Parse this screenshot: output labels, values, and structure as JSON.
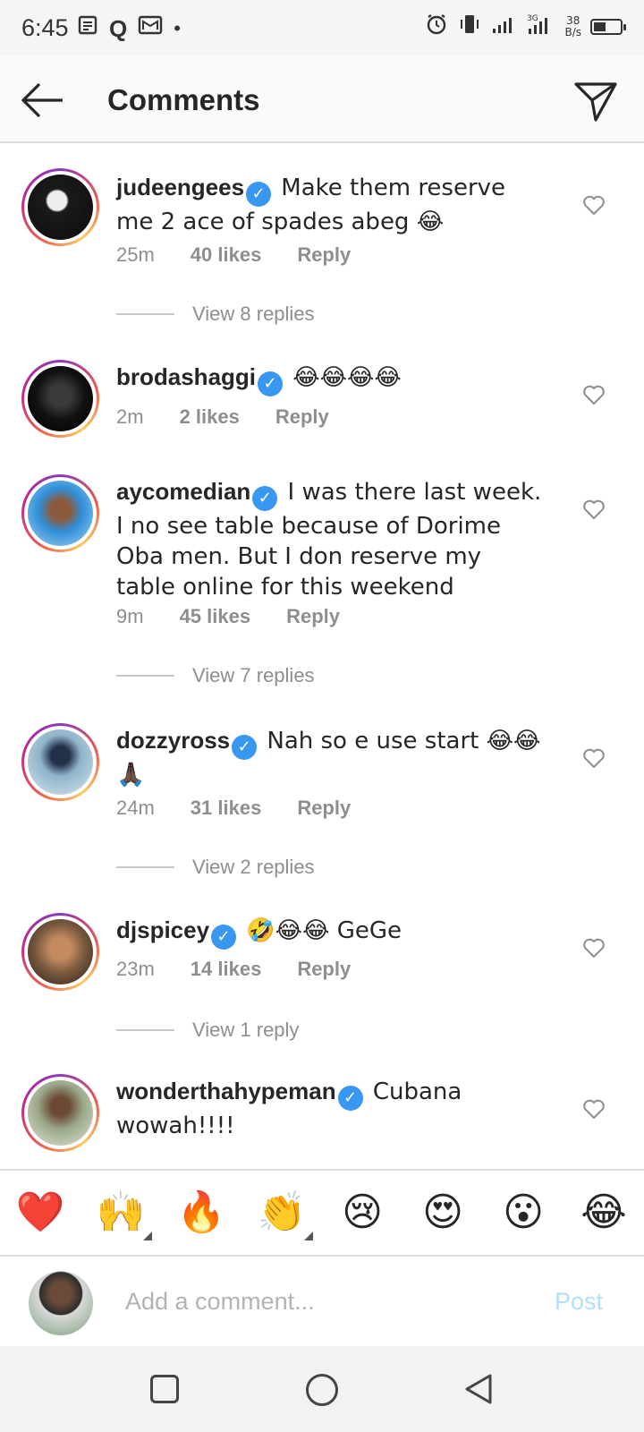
{
  "status_bar": {
    "time": "6:45",
    "left_icons": [
      "notes-icon",
      "q-app-icon",
      "mail-icon",
      "dot"
    ],
    "network_speed_top": "38",
    "network_speed_bottom": "B/s",
    "signal_label": "3G"
  },
  "header": {
    "title": "Comments"
  },
  "comments": [
    {
      "user": "judeengees",
      "verified": true,
      "text": "Make them reserve me 2 ace of spades abeg 😂",
      "time": "25m",
      "likes": "40 likes",
      "reply": "Reply",
      "view_replies": "View 8 replies",
      "avatar_color": "#1a1a1a"
    },
    {
      "user": "brodashaggi",
      "verified": true,
      "text": "😂😂😂😂",
      "time": "2m",
      "likes": "2 likes",
      "reply": "Reply",
      "view_replies": "",
      "avatar_color": "#111111"
    },
    {
      "user": "aycomedian",
      "verified": true,
      "text": "I was there last week. I no see table because of Dorime Oba men. But I don reserve my table online for this weekend",
      "time": "9m",
      "likes": "45 likes",
      "reply": "Reply",
      "view_replies": "View 7 replies",
      "avatar_color": "#2f8fd8"
    },
    {
      "user": "dozzyross",
      "verified": true,
      "text": "Nah so e use start 😂😂🙏🏿",
      "time": "24m",
      "likes": "31 likes",
      "reply": "Reply",
      "view_replies": "View 2 replies",
      "avatar_color": "#8fb3c9"
    },
    {
      "user": "djspicey",
      "verified": true,
      "text": "🤣😂😂 GeGe",
      "time": "23m",
      "likes": "14 likes",
      "reply": "Reply",
      "view_replies": "View 1 reply",
      "avatar_color": "#7a5a40"
    },
    {
      "user": "wonderthahypeman",
      "verified": true,
      "text": "Cubana wowah!!!!",
      "time": "",
      "likes": "",
      "reply": "",
      "view_replies": "",
      "avatar_color": "#9aa88a"
    }
  ],
  "emoji_bar": [
    "❤️",
    "🙌",
    "🔥",
    "👏",
    "😢",
    "😍",
    "😮",
    "😂"
  ],
  "input": {
    "placeholder": "Add a comment...",
    "post_label": "Post"
  },
  "colors": {
    "verified": "#3897f0",
    "meta": "#8e8e8e",
    "post_disabled": "#b2dffc"
  }
}
